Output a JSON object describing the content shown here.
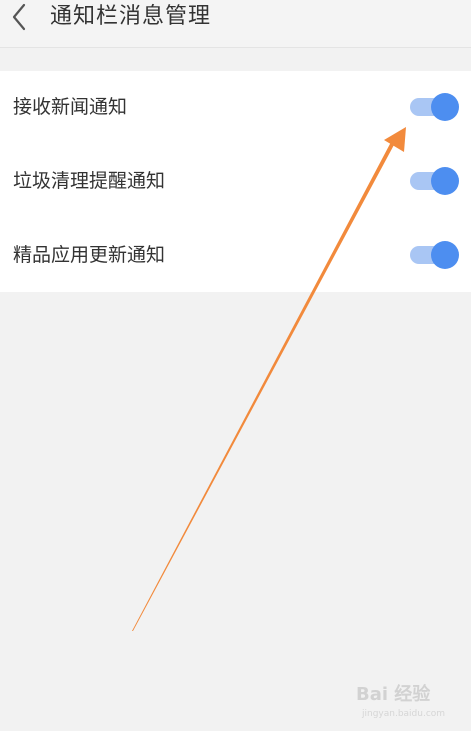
{
  "header": {
    "back_icon": "chevron-left-icon",
    "title": "通知栏消息管理"
  },
  "settings": {
    "items": [
      {
        "label": "接收新闻通知",
        "enabled": true
      },
      {
        "label": "垃圾清理提醒通知",
        "enabled": true
      },
      {
        "label": "精品应用更新通知",
        "enabled": true
      }
    ]
  },
  "colors": {
    "toggle_on": "#4d8ef0",
    "toggle_track": "#a9c6f4",
    "annotation_arrow": "#f28a3c",
    "background": "#f2f2f2"
  },
  "watermark": {
    "brand": "Bai 经验",
    "url": "jingyan.baidu.com"
  }
}
